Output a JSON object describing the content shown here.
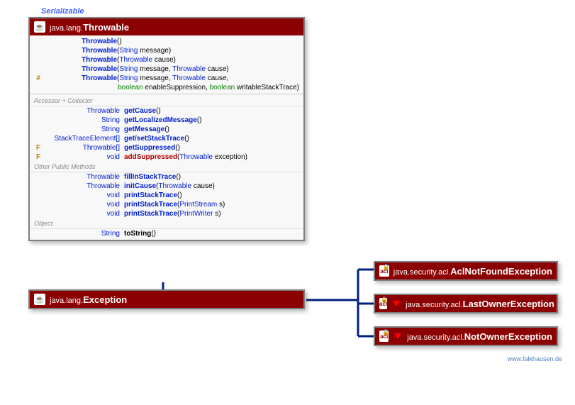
{
  "serializable_label": "Serializable",
  "throwable": {
    "package": "java.lang.",
    "name": "Throwable",
    "constructors": [
      {
        "name": "Throwable",
        "params": "()"
      },
      {
        "name": "Throwable",
        "params_html": "(<span class='tparam'>String</span> message)"
      },
      {
        "name": "Throwable",
        "params_html": "(<span class='tparam'>Throwable</span> cause)"
      },
      {
        "name": "Throwable",
        "params_html": "(<span class='tparam'>String</span> message, <span class='tparam'>Throwable</span> cause)"
      },
      {
        "mod": "#",
        "name": "Throwable",
        "params_html": "(<span class='tparam'>String</span> message, <span class='tparam'>Throwable</span> cause,"
      },
      {
        "cont": true,
        "params_html": "<span class='kw'>boolean</span> enableSuppression, <span class='kw'>boolean</span> writableStackTrace)"
      }
    ],
    "section_accessor": "Accessor + Collector",
    "accessors": [
      {
        "rtype": "Throwable",
        "name": "getCause",
        "params": "()"
      },
      {
        "rtype": "String",
        "name": "getLocalizedMessage",
        "params": "()"
      },
      {
        "rtype": "String",
        "name": "getMessage",
        "params": "()"
      },
      {
        "rtype": "StackTraceElement[]",
        "name": "get/setStackTrace",
        "params": "()"
      },
      {
        "mod": "F",
        "rtype": "Throwable[]",
        "name": "getSuppressed",
        "params": "()"
      },
      {
        "mod": "F",
        "rtype": "void",
        "name": "addSuppressed",
        "params_html": "(<span class='tparam'>Throwable</span> exception)",
        "red": true
      }
    ],
    "section_other": "Other Public Methods",
    "others": [
      {
        "rtype": "Throwable",
        "name": "fillInStackTrace",
        "params": "()"
      },
      {
        "rtype": "Throwable",
        "name": "initCause",
        "params_html": "(<span class='tparam'>Throwable</span> cause)"
      },
      {
        "rtype": "void",
        "name": "printStackTrace",
        "params": "()"
      },
      {
        "rtype": "void",
        "name": "printStackTrace",
        "params_html": "(<span class='tparam'>PrintStream</span> s)"
      },
      {
        "rtype": "void",
        "name": "printStackTrace",
        "params_html": "(<span class='tparam'>PrintWriter</span> s)"
      }
    ],
    "section_object": "Object",
    "object_methods": [
      {
        "rtype": "String",
        "name": "toString",
        "params": "()",
        "plain": true
      }
    ]
  },
  "exception": {
    "package": "java.lang.",
    "name": "Exception"
  },
  "acl1": {
    "package": "java.security.acl.",
    "name": "AclNotFoundException"
  },
  "acl2": {
    "package": "java.security.acl.",
    "name": "LastOwnerException"
  },
  "acl3": {
    "package": "java.security.acl.",
    "name": "NotOwnerException"
  },
  "watermark": "www.falkhausen.de"
}
